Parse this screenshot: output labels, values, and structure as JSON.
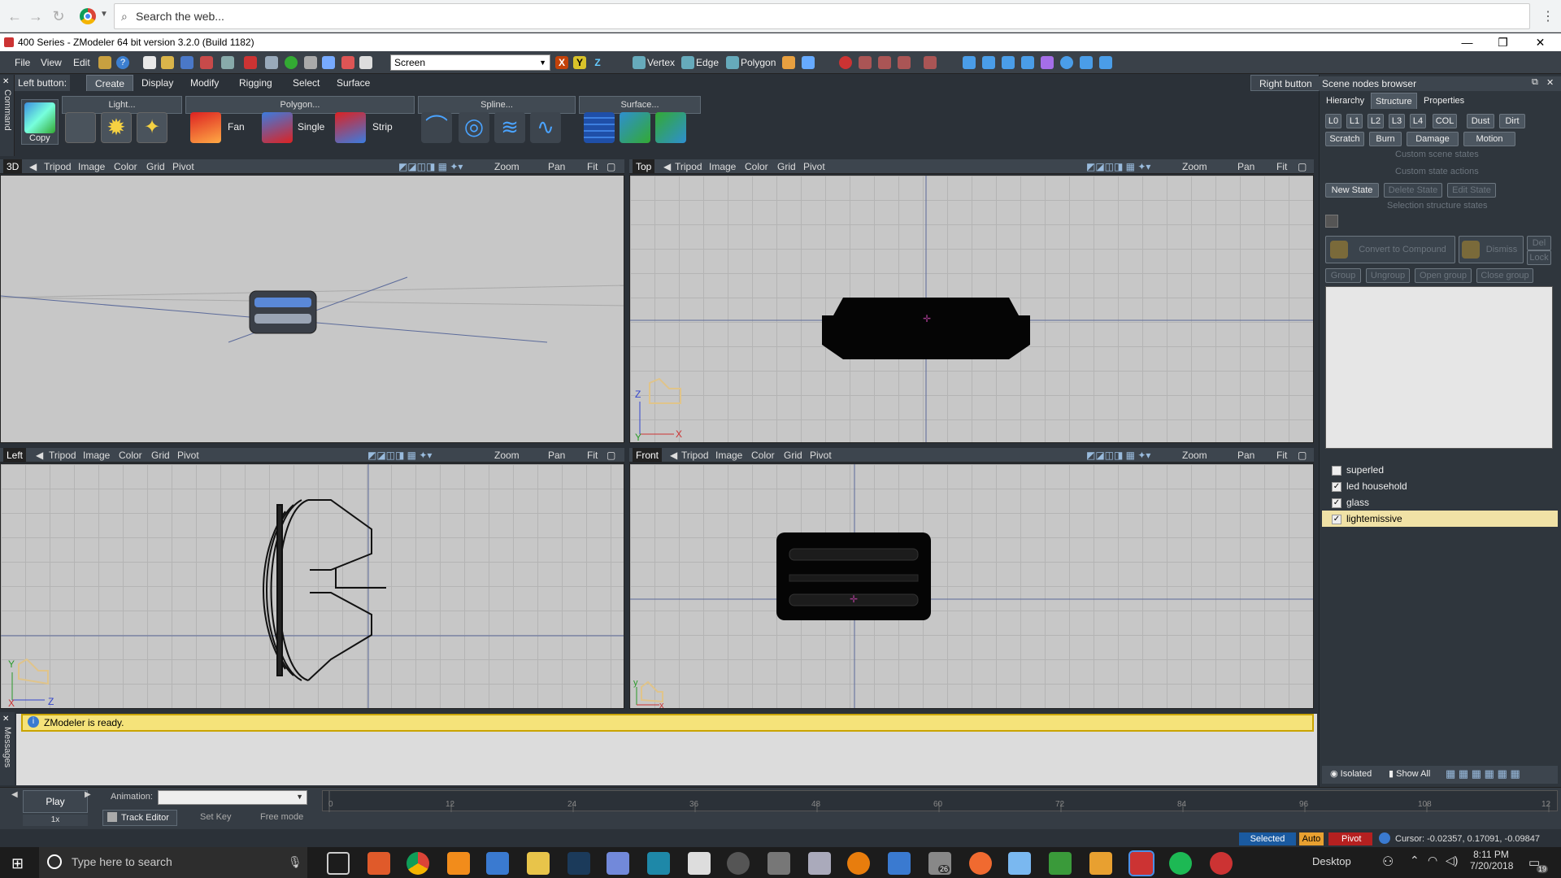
{
  "browser": {
    "search_placeholder": "Search the web..."
  },
  "window": {
    "title": "400 Series - ZModeler 64 bit version 3.2.0 (Build 1182)"
  },
  "menu": [
    "File",
    "View",
    "Edit"
  ],
  "toolbar": {
    "selection_mode": "Screen",
    "axis_x": "X",
    "axis_y": "Y",
    "axis_z": "Z",
    "vertex": "Vertex",
    "edge": "Edge",
    "polygon": "Polygon"
  },
  "command": {
    "strip_label": "Command",
    "left_button": "Left button:",
    "right_button": "Right button",
    "tabs": [
      "Create",
      "Display",
      "Modify",
      "Rigging",
      "Select",
      "Surface"
    ],
    "active_tab": "Create",
    "groups": {
      "light": "Light...",
      "polygon": "Polygon...",
      "spline": "Spline...",
      "surface": "Surface..."
    },
    "buttons": {
      "copy": "Copy",
      "fan": "Fan",
      "single": "Single",
      "strip": "Strip"
    }
  },
  "viewports": [
    {
      "name": "3D",
      "items": [
        "Tripod",
        "Image",
        "Color",
        "Grid",
        "Pivot"
      ],
      "zoom": "Zoom",
      "pan": "Pan",
      "fit": "Fit"
    },
    {
      "name": "Top",
      "items": [
        "Tripod",
        "Image",
        "Color",
        "Grid",
        "Pivot"
      ],
      "zoom": "Zoom",
      "pan": "Pan",
      "fit": "Fit",
      "axis_a": "Z",
      "axis_b": "X",
      "axis_c": "Y"
    },
    {
      "name": "Left",
      "items": [
        "Tripod",
        "Image",
        "Color",
        "Grid",
        "Pivot"
      ],
      "zoom": "Zoom",
      "pan": "Pan",
      "fit": "Fit",
      "axis_a": "Y",
      "axis_b": "Z",
      "axis_c": "X"
    },
    {
      "name": "Front",
      "items": [
        "Tripod",
        "Image",
        "Color",
        "Grid",
        "Pivot"
      ],
      "zoom": "Zoom",
      "pan": "Pan",
      "fit": "Fit",
      "axis_a": "y",
      "axis_b": "x"
    }
  ],
  "scene": {
    "title": "Scene nodes browser",
    "tabs": [
      "Hierarchy",
      "Structure",
      "Properties"
    ],
    "active_tab": "Structure",
    "lods": [
      "L0",
      "L1",
      "L2",
      "L3",
      "L4",
      "COL",
      "Dust",
      "Dirt"
    ],
    "row2": [
      "Scratch",
      "Burn",
      "Damage",
      "Motion"
    ],
    "custom_scene_states": "Custom scene states",
    "custom_state_actions": "Custom state actions",
    "new_state": "New State",
    "delete_state": "Delete State",
    "edit_state": "Edit State",
    "selection_structure_states": "Selection structure states",
    "convert": "Convert to Compound",
    "dismiss": "Dismiss",
    "del": "Del",
    "lock": "Lock",
    "group": "Group",
    "ungroup": "Ungroup",
    "open_group": "Open group",
    "close_group": "Close group",
    "nodes": [
      {
        "name": "superled",
        "checked": false
      },
      {
        "name": "led household",
        "checked": true
      },
      {
        "name": "glass",
        "checked": true
      },
      {
        "name": "lightemissive",
        "checked": true,
        "selected": true
      }
    ],
    "isolated": "Isolated",
    "show_all": "Show All"
  },
  "messages": {
    "strip_label": "Messages",
    "text": "ZModeler is ready."
  },
  "timeline": {
    "play": "Play",
    "speed": "1x",
    "animation_label": "Animation:",
    "track_editor": "Track Editor",
    "set_key": "Set Key",
    "free_mode": "Free mode",
    "ticks": [
      "0",
      "12",
      "24",
      "36",
      "48",
      "60",
      "72",
      "84",
      "96",
      "108",
      "12"
    ]
  },
  "status": {
    "selected": "Selected",
    "auto": "Auto",
    "pivot": "Pivot",
    "cursor": "Cursor: -0.02357, 0.17091, -0.09847"
  },
  "taskbar": {
    "search": "Type here to search",
    "desktop": "Desktop",
    "time": "8:11 PM",
    "date": "7/20/2018",
    "mail_badge": "26",
    "notif_badge": "19"
  }
}
